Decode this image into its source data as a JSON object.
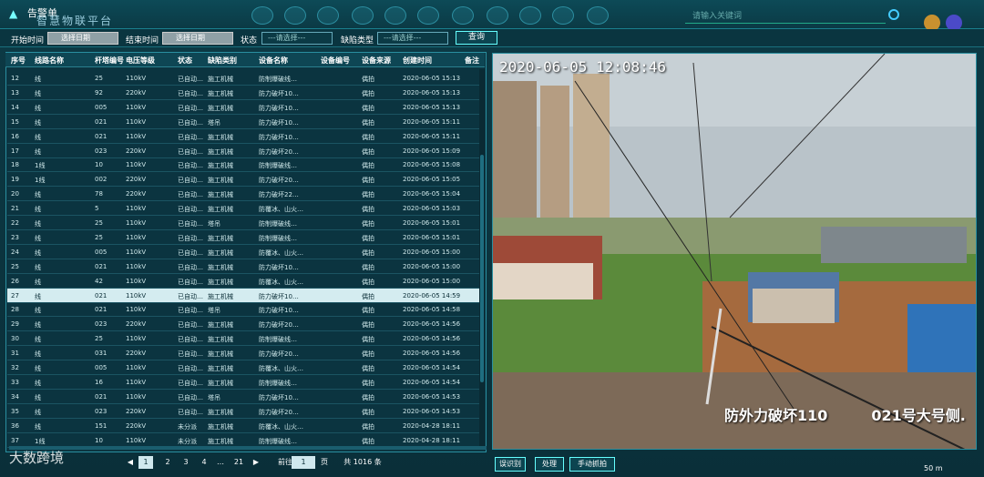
{
  "dialog_title": "告警单",
  "platform_name": "智慧物联平台",
  "search": {
    "placeholder": "请输入关键词"
  },
  "filters": {
    "start_label": "开始时间",
    "start_placeholder": "选择日期",
    "end_label": "结束时间",
    "end_placeholder": "选择日期",
    "status_label": "状态",
    "status_value": "---请选择---",
    "defect_label": "缺陷类型",
    "defect_value": "---请选择---",
    "query_label": "查询"
  },
  "table": {
    "headers": [
      "序号",
      "线路名称",
      "杆塔编号",
      "电压等级",
      "状态",
      "缺陷类别",
      "设备名称",
      "设备编号",
      "设备来源",
      "创建时间",
      "备注"
    ],
    "rows": [
      [
        "12",
        "线",
        "25",
        "110kV",
        "已自动…",
        "施工机械",
        "防制爆破线…",
        "",
        "偶拍",
        "2020-06-05 15:13"
      ],
      [
        "13",
        "线",
        "92",
        "220kV",
        "已自动…",
        "施工机械",
        "防力破坏10…",
        "",
        "偶拍",
        "2020-06-05 15:13"
      ],
      [
        "14",
        "线",
        "005",
        "110kV",
        "已自动…",
        "施工机械",
        "防力破坏10…",
        "",
        "偶拍",
        "2020-06-05 15:13"
      ],
      [
        "15",
        "线",
        "021",
        "110kV",
        "已自动…",
        "塔吊",
        "防力破坏10…",
        "",
        "偶拍",
        "2020-06-05 15:11"
      ],
      [
        "16",
        "线",
        "021",
        "110kV",
        "已自动…",
        "施工机械",
        "防力破坏10…",
        "",
        "偶拍",
        "2020-06-05 15:11"
      ],
      [
        "17",
        "线",
        "023",
        "220kV",
        "已自动…",
        "施工机械",
        "防力破坏20…",
        "",
        "偶拍",
        "2020-06-05 15:09"
      ],
      [
        "18",
        "1线",
        "10",
        "110kV",
        "已自动…",
        "施工机械",
        "防制爆破线…",
        "",
        "偶拍",
        "2020-06-05 15:08"
      ],
      [
        "19",
        "1线",
        "002",
        "220kV",
        "已自动…",
        "施工机械",
        "防力破坏20…",
        "",
        "偶拍",
        "2020-06-05 15:05"
      ],
      [
        "20",
        "线",
        "78",
        "220kV",
        "已自动…",
        "施工机械",
        "防力破坏22…",
        "",
        "偶拍",
        "2020-06-05 15:04"
      ],
      [
        "21",
        "线",
        "5",
        "110kV",
        "已自动…",
        "施工机械",
        "防覆冰、山火…",
        "",
        "偶拍",
        "2020-06-05 15:03"
      ],
      [
        "22",
        "线",
        "25",
        "110kV",
        "已自动…",
        "塔吊",
        "防制爆破线…",
        "",
        "偶拍",
        "2020-06-05 15:01"
      ],
      [
        "23",
        "线",
        "25",
        "110kV",
        "已自动…",
        "施工机械",
        "防制爆破线…",
        "",
        "偶拍",
        "2020-06-05 15:01"
      ],
      [
        "24",
        "线",
        "005",
        "110kV",
        "已自动…",
        "施工机械",
        "防覆冰、山火…",
        "",
        "偶拍",
        "2020-06-05 15:00"
      ],
      [
        "25",
        "线",
        "021",
        "110kV",
        "已自动…",
        "施工机械",
        "防力破坏10…",
        "",
        "偶拍",
        "2020-06-05 15:00"
      ],
      [
        "26",
        "线",
        "42",
        "110kV",
        "已自动…",
        "施工机械",
        "防覆冰、山火…",
        "",
        "偶拍",
        "2020-06-05 15:00"
      ],
      [
        "27",
        "线",
        "021",
        "110kV",
        "已自动…",
        "施工机械",
        "防力破坏10…",
        "",
        "偶拍",
        "2020-06-05 14:59"
      ],
      [
        "28",
        "线",
        "021",
        "110kV",
        "已自动…",
        "塔吊",
        "防力破坏10…",
        "",
        "偶拍",
        "2020-06-05 14:58"
      ],
      [
        "29",
        "线",
        "023",
        "220kV",
        "已自动…",
        "施工机械",
        "防力破坏20…",
        "",
        "偶拍",
        "2020-06-05 14:56"
      ],
      [
        "30",
        "线",
        "25",
        "110kV",
        "已自动…",
        "施工机械",
        "防制爆破线…",
        "",
        "偶拍",
        "2020-06-05 14:56"
      ],
      [
        "31",
        "线",
        "031",
        "220kV",
        "已自动…",
        "施工机械",
        "防力破坏20…",
        "",
        "偶拍",
        "2020-06-05 14:56"
      ],
      [
        "32",
        "线",
        "005",
        "110kV",
        "已自动…",
        "施工机械",
        "防覆冰、山火…",
        "",
        "偶拍",
        "2020-06-05 14:54"
      ],
      [
        "33",
        "线",
        "16",
        "110kV",
        "已自动…",
        "施工机械",
        "防制爆破线…",
        "",
        "偶拍",
        "2020-06-05 14:54"
      ],
      [
        "34",
        "线",
        "021",
        "110kV",
        "已自动…",
        "塔吊",
        "防力破坏10…",
        "",
        "偶拍",
        "2020-06-05 14:53"
      ],
      [
        "35",
        "线",
        "023",
        "220kV",
        "已自动…",
        "施工机械",
        "防力破坏20…",
        "",
        "偶拍",
        "2020-06-05 14:53"
      ],
      [
        "36",
        "线",
        "151",
        "220kV",
        "未分派",
        "施工机械",
        "防覆冰、山火…",
        "",
        "偶拍",
        "2020-04-28 18:11"
      ],
      [
        "37",
        "1线",
        "10",
        "110kV",
        "未分派",
        "施工机械",
        "防制爆破线…",
        "",
        "偶拍",
        "2020-04-28 18:11"
      ]
    ]
  },
  "pager": {
    "pages": [
      "1",
      "2",
      "3",
      "4",
      "…",
      "21"
    ],
    "goto_label": "前往",
    "goto_value": "1",
    "page_unit": "页",
    "total": "共 1016 条"
  },
  "watermark": "大数跨境",
  "video": {
    "timestamp": "2020-06-05 12:08:46",
    "caption": "防外力破坏110　　　021号大号侧."
  },
  "actions": {
    "btn1": "误识别",
    "btn2": "处理",
    "btn3": "手动抓拍"
  },
  "map_scale": "50 m"
}
